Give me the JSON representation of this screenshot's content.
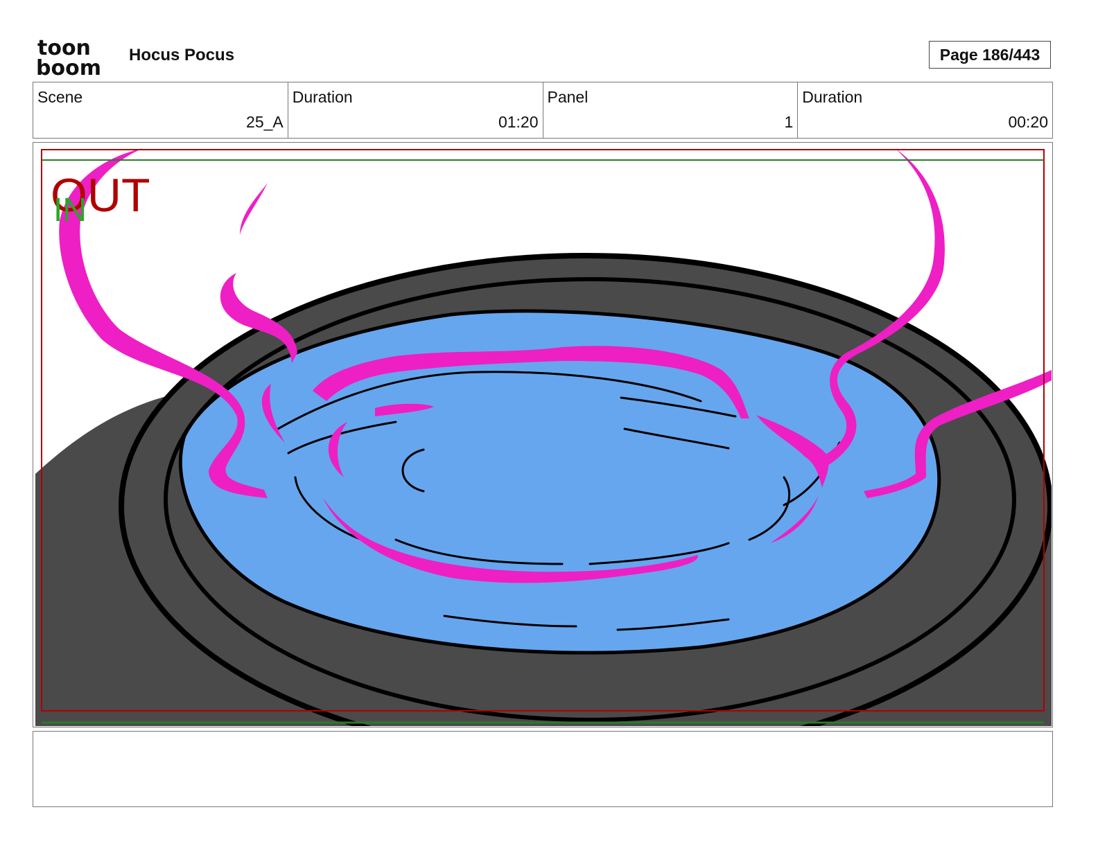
{
  "header": {
    "logo_top": "toon",
    "logo_bottom": "boom",
    "project_title": "Hocus Pocus",
    "page_label": "Page 186/443"
  },
  "info": {
    "scene_label": "Scene",
    "scene_value": "25_A",
    "scene_duration_label": "Duration",
    "scene_duration_value": "01:20",
    "panel_label": "Panel",
    "panel_value": "1",
    "panel_duration_label": "Duration",
    "panel_duration_value": "00:20"
  },
  "panel": {
    "out_marker": "OUT",
    "in_marker": "IN",
    "colors": {
      "cauldron": "#4a4a4a",
      "liquid": "#66a6ee",
      "magic": "#ee1fc4",
      "outline": "#000000",
      "safe_frame": "#b00000",
      "camera_frame": "#2a7a2a"
    }
  },
  "notes": {
    "text": ""
  }
}
